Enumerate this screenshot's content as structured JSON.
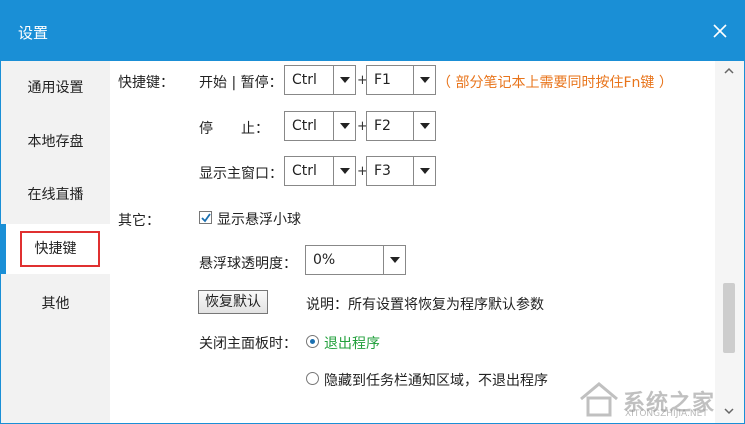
{
  "window": {
    "title": "设置"
  },
  "sidebar": {
    "items": [
      {
        "label": "通用设置"
      },
      {
        "label": "本地存盘"
      },
      {
        "label": "在线直播"
      },
      {
        "label": "快捷键"
      },
      {
        "label": "其他"
      }
    ],
    "active_index": 3
  },
  "hotkeys": {
    "section_label": "快捷键：",
    "rows": [
      {
        "label": "开始 | 暂停：",
        "modifier": "Ctrl",
        "key": "F1"
      },
      {
        "label": "停　　止：",
        "modifier": "Ctrl",
        "key": "F2"
      },
      {
        "label": "显示主窗口：",
        "modifier": "Ctrl",
        "key": "F3"
      }
    ],
    "plus": "+",
    "note": "（ 部分笔记本上需要同时按住Fn键 ）"
  },
  "other": {
    "section_label": "其它：",
    "float_ball_checkbox": {
      "label": "显示悬浮小球",
      "checked": true
    },
    "opacity": {
      "label": "悬浮球透明度：",
      "value": "0%"
    },
    "restore_button": "恢复默认",
    "restore_note": "说明：所有设置将恢复为程序默认参数",
    "close_panel": {
      "label": "关闭主面板时：",
      "options": [
        {
          "label": "退出程序",
          "selected": true
        },
        {
          "label": "隐藏到任务栏通知区域，不退出程序",
          "selected": false
        }
      ]
    }
  },
  "watermark": {
    "text": "系统之家",
    "url": "XITONGZHIJIA.NET"
  },
  "colors": {
    "accent": "#1a8fd6",
    "highlight_box": "#e03030",
    "note": "#e8741b",
    "selected_option": "#22a03c"
  }
}
